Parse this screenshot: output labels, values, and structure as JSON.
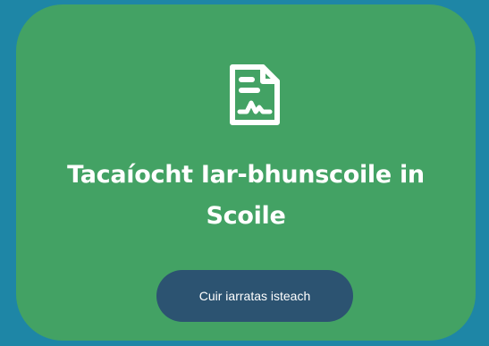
{
  "card": {
    "icon": "document-chart-icon",
    "title_line1": "Tacaíocht Iar-bhunscoile in",
    "title_line2": "Scoile",
    "button_label": "Cuir iarratas isteach"
  },
  "colors": {
    "page_background": "#1e86a6",
    "card_background": "#43a264",
    "button_background": "#2c5371",
    "text": "#ffffff"
  }
}
